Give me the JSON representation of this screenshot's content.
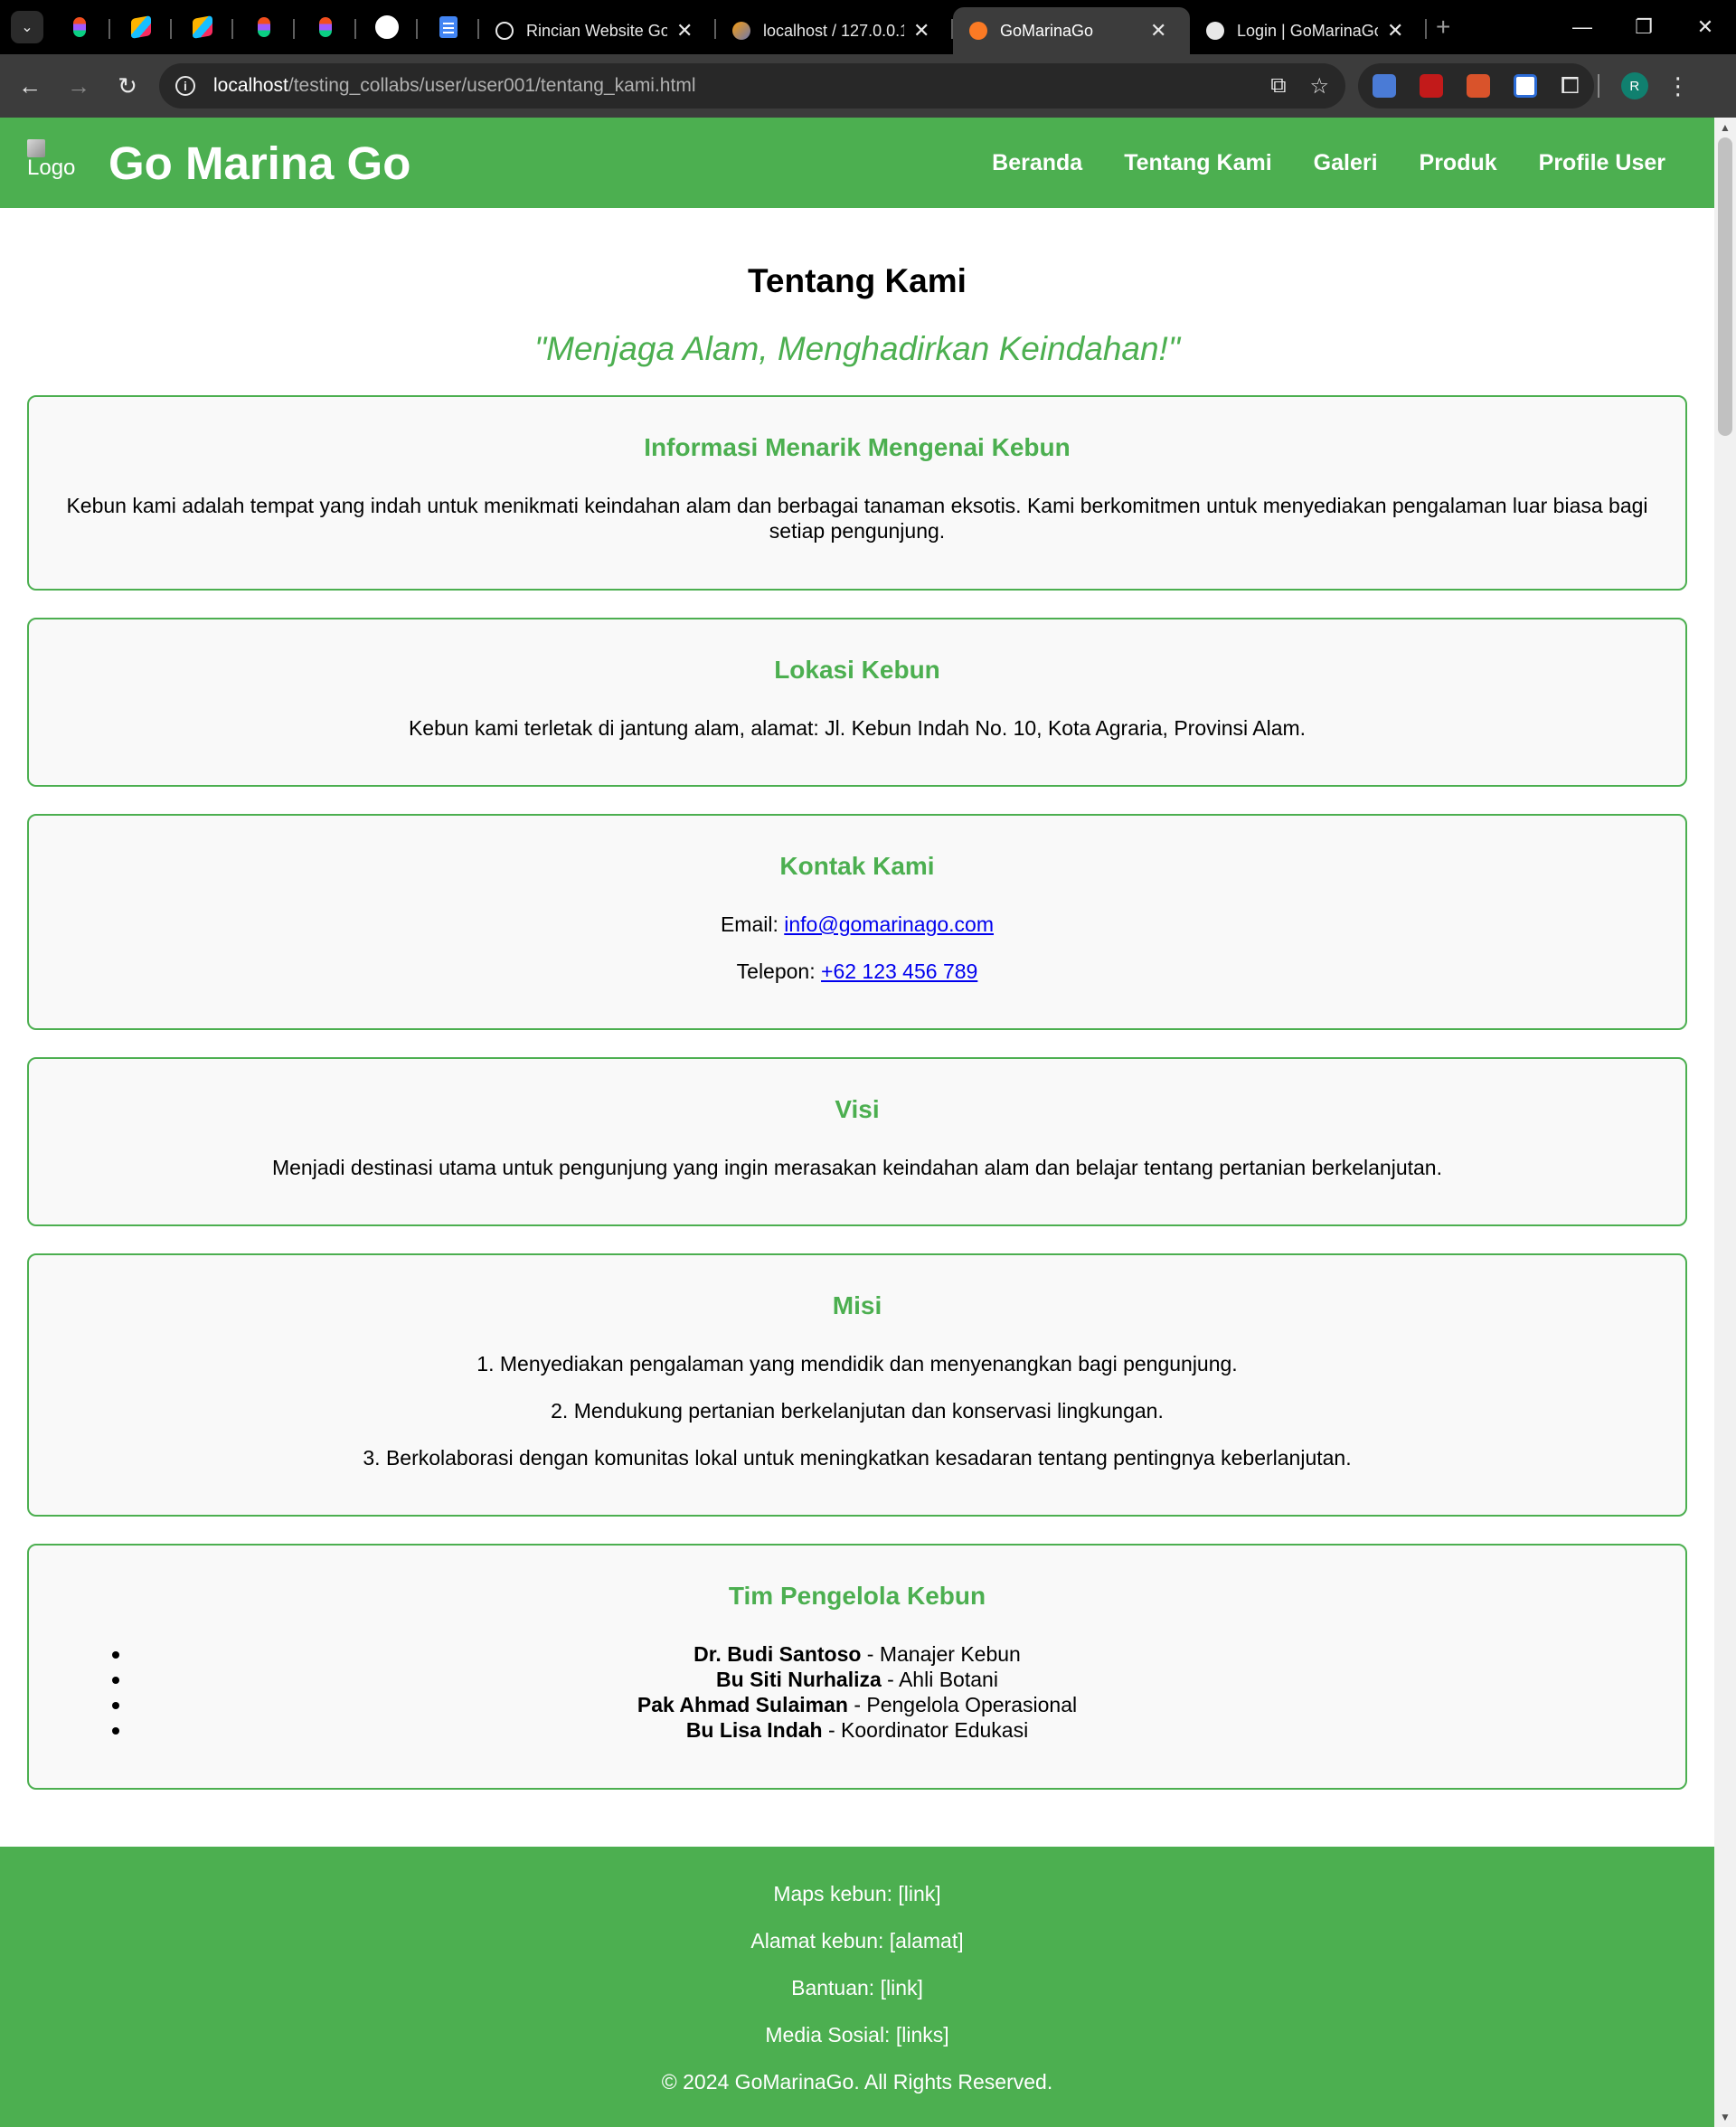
{
  "browser": {
    "tabs": [
      {
        "title": "Rincian Website Go",
        "close": "✕"
      },
      {
        "title": "localhost / 127.0.0.1",
        "close": "✕"
      },
      {
        "title": "GoMarinaGo",
        "close": "✕"
      },
      {
        "title": "Login | GoMarinaGo",
        "close": "✕"
      }
    ],
    "new_tab": "+",
    "url_host": "localhost",
    "url_path": "/testing_collabs/user/user001/tentang_kami.html",
    "profile_initial": "R",
    "colors": {
      "tabbar": "#000000",
      "toolbar": "#3c3c3c",
      "omnibox": "#282828"
    }
  },
  "header": {
    "logo_alt": "Logo",
    "brand": "Go Marina Go",
    "nav": [
      "Beranda",
      "Tentang Kami",
      "Galeri",
      "Produk",
      "Profile User"
    ]
  },
  "main": {
    "title": "Tentang Kami",
    "tagline": "\"Menjaga Alam, Menghadirkan Keindahan!\"",
    "info": {
      "heading": "Informasi Menarik Mengenai Kebun",
      "text": "Kebun kami adalah tempat yang indah untuk menikmati keindahan alam dan berbagai tanaman eksotis. Kami berkomitmen untuk menyediakan pengalaman luar biasa bagi setiap pengunjung."
    },
    "location": {
      "heading": "Lokasi Kebun",
      "text": "Kebun kami terletak di jantung alam, alamat: Jl. Kebun Indah No. 10, Kota Agraria, Provinsi Alam."
    },
    "contact": {
      "heading": "Kontak Kami",
      "email_label": "Email: ",
      "email": "info@gomarinago.com",
      "phone_label": "Telepon: ",
      "phone": "+62 123 456 789"
    },
    "vision": {
      "heading": "Visi",
      "text": "Menjadi destinasi utama untuk pengunjung yang ingin merasakan keindahan alam dan belajar tentang pertanian berkelanjutan."
    },
    "mission": {
      "heading": "Misi",
      "items": [
        "1. Menyediakan pengalaman yang mendidik dan menyenangkan bagi pengunjung.",
        "2. Mendukung pertanian berkelanjutan dan konservasi lingkungan.",
        "3. Berkolaborasi dengan komunitas lokal untuk meningkatkan kesadaran tentang pentingnya keberlanjutan."
      ]
    },
    "team": {
      "heading": "Tim Pengelola Kebun",
      "members": [
        {
          "name": "Dr. Budi Santoso",
          "role": " - Manajer Kebun"
        },
        {
          "name": "Bu Siti Nurhaliza",
          "role": " - Ahli Botani"
        },
        {
          "name": "Pak Ahmad Sulaiman",
          "role": " - Pengelola Operasional"
        },
        {
          "name": "Bu Lisa Indah",
          "role": " - Koordinator Edukasi"
        }
      ]
    }
  },
  "footer": {
    "lines": [
      "Maps kebun: [link]",
      "Alamat kebun: [alamat]",
      "Bantuan: [link]",
      "Media Sosial: [links]",
      "© 2024 GoMarinaGo. All Rights Reserved."
    ]
  },
  "theme": {
    "accent": "#4caf50",
    "card_bg": "#f9f9f9",
    "link": "#0000ee"
  }
}
